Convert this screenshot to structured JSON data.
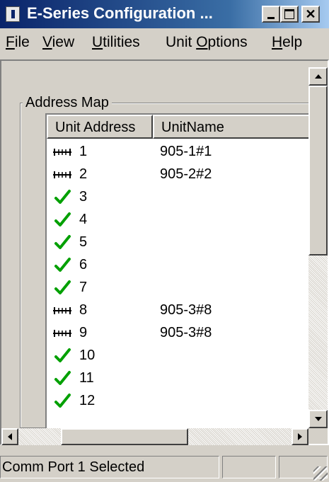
{
  "window": {
    "title": "E-Series Configuration ..."
  },
  "menu": [
    {
      "label": "File",
      "accel": "F",
      "rest": "ile"
    },
    {
      "label": "View",
      "accel": "V",
      "rest": "iew"
    },
    {
      "label": "Utilities",
      "accel": "U",
      "rest": "tilities"
    },
    {
      "label": "Unit Options",
      "pre": "Unit ",
      "accel": "O",
      "rest": "ptions"
    },
    {
      "label": "Help",
      "accel": "H",
      "rest": "elp"
    }
  ],
  "address_map": {
    "group_label": "Address Map",
    "columns": [
      "Unit Address",
      "UnitName"
    ],
    "rows": [
      {
        "icon": "ladder-icon",
        "address": "1",
        "name": "905-1#1"
      },
      {
        "icon": "ladder-icon",
        "address": "2",
        "name": "905-2#2"
      },
      {
        "icon": "check-icon",
        "address": "3",
        "name": ""
      },
      {
        "icon": "check-icon",
        "address": "4",
        "name": ""
      },
      {
        "icon": "check-icon",
        "address": "5",
        "name": ""
      },
      {
        "icon": "check-icon",
        "address": "6",
        "name": ""
      },
      {
        "icon": "check-icon",
        "address": "7",
        "name": ""
      },
      {
        "icon": "ladder-icon",
        "address": "8",
        "name": "905-3#8"
      },
      {
        "icon": "ladder-icon",
        "address": "9",
        "name": "905-3#8"
      },
      {
        "icon": "check-icon",
        "address": "10",
        "name": ""
      },
      {
        "icon": "check-icon",
        "address": "11",
        "name": ""
      },
      {
        "icon": "check-icon",
        "address": "12",
        "name": ""
      }
    ]
  },
  "status": {
    "text": "Comm Port 1 Selected"
  },
  "colors": {
    "title_start": "#0a246a",
    "title_end": "#a6caf0",
    "check": "#00a000"
  }
}
